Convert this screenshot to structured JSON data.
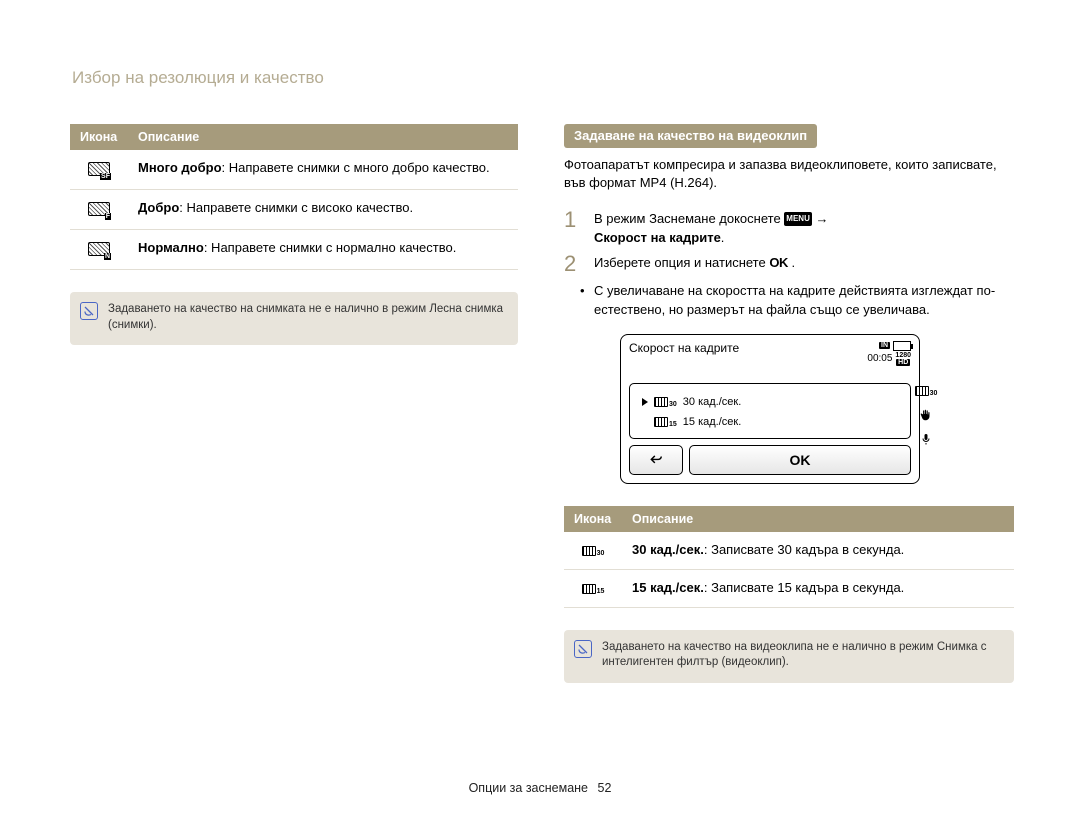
{
  "page": {
    "title": "Избор на резолюция и качество",
    "footer_label": "Опции за заснемане",
    "page_number": "52"
  },
  "left_table": {
    "head_icon": "Икона",
    "head_desc": "Описание",
    "rows": [
      {
        "bold": "Много добро",
        "rest": ": Направете снимки с много добро качество."
      },
      {
        "bold": "Добро",
        "rest": ": Направете снимки с високо качество."
      },
      {
        "bold": "Нормално",
        "rest": ": Направете снимки с нормално качество."
      }
    ]
  },
  "left_note": "Задаването на качество на снимката не е налично в режим Лесна снимка (снимки).",
  "right": {
    "section_title": "Задаване на качество на видеоклип",
    "intro": "Фотоапаратът компресира и запазва видеоклиповете, които записвате, във формат MP4 (H.264).",
    "step1_a": "В режим Заснемане докоснете ",
    "menu_chip": "MENU",
    "step1_arrow": " → ",
    "step1_bold": "Скорост на кадрите",
    "step1_after": ".",
    "step2_a": "Изберете опция и натиснете ",
    "ok_chip": "OK",
    "step2_after": " .",
    "bullet": "С увеличаване на скоростта на кадрите действията изглеждат по-естествено, но размерът на файла също се увеличава.",
    "device": {
      "title": "Скорост на кадрите",
      "in_label": "IN",
      "time": "00:05",
      "res_badge": "1280",
      "hd_label": "HD",
      "row1": "30 кад./сек.",
      "row2": "15 кад./сек.",
      "ok": "OK"
    }
  },
  "right_table": {
    "head_icon": "Икона",
    "head_desc": "Описание",
    "rows": [
      {
        "bold": "30 кад./сек.",
        "rest": ": Записвате 30 кадъра в секунда."
      },
      {
        "bold": "15 кад./сек.",
        "rest": ": Записвате 15 кадъра в секунда."
      }
    ]
  },
  "right_note": "Задаването на качество на видеоклипа не е налично в режим Снимка с интелигентен филтър (видеоклип)."
}
